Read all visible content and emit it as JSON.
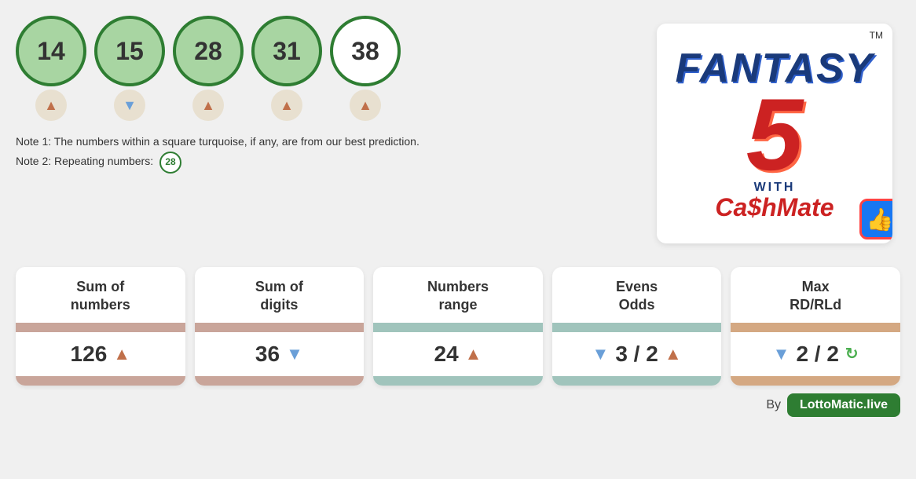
{
  "balls": [
    {
      "number": "14",
      "bg": "green-bg",
      "arrow": "up"
    },
    {
      "number": "15",
      "bg": "green-bg",
      "arrow": "down"
    },
    {
      "number": "28",
      "bg": "green-bg",
      "arrow": "up"
    },
    {
      "number": "31",
      "bg": "green-bg",
      "arrow": "up"
    },
    {
      "number": "38",
      "bg": "white-bg",
      "arrow": "up"
    }
  ],
  "note1": "Note 1: The numbers within a square turquoise, if any, are from our best prediction.",
  "note2_prefix": "Note 2: Repeating numbers:",
  "repeating_number": "28",
  "logo": {
    "fantasy": "Fantasy",
    "number": "5",
    "with": "WITH",
    "cashmate": "Ca$hMate",
    "tm": "TM"
  },
  "stats": [
    {
      "label": "Sum of\nnumbers",
      "value": "126",
      "arrow": "up",
      "bar_color": "rose"
    },
    {
      "label": "Sum of\ndigits",
      "value": "36",
      "arrow": "down",
      "bar_color": "rose"
    },
    {
      "label": "Numbers\nrange",
      "value": "24",
      "arrow": "up",
      "bar_color": "teal"
    },
    {
      "label": "Evens\nOdds",
      "value": "3 / 2",
      "arrow_left": "down",
      "arrow_right": "up",
      "bar_color": "teal"
    },
    {
      "label": "Max\nRD/RLd",
      "value": "2 / 2",
      "arrow_left": "down",
      "arrow_right": "refresh",
      "bar_color": "peach"
    }
  ],
  "footer": {
    "by": "By",
    "brand": "LottoMatic.live"
  }
}
